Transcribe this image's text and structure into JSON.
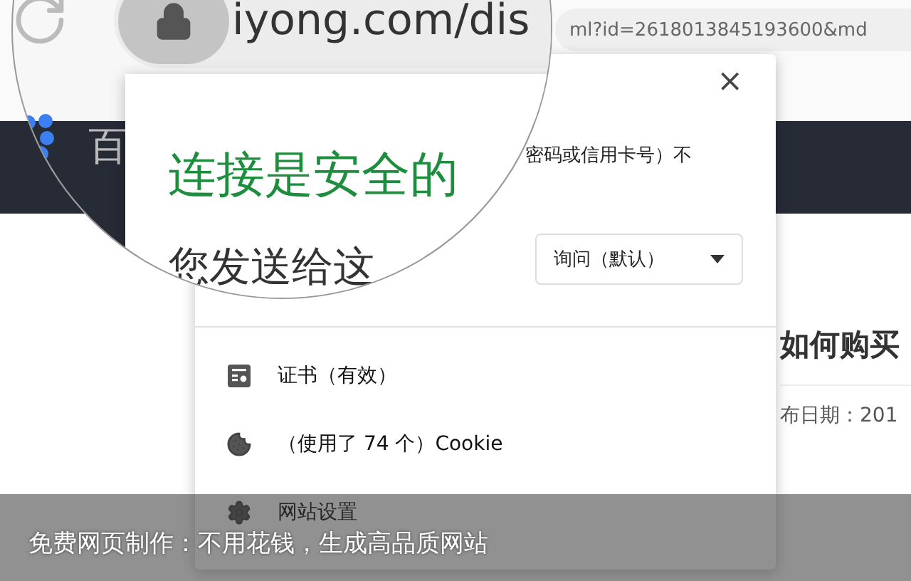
{
  "toolbar": {
    "url_tail": "ml?id=2618013845193600&md"
  },
  "magnifier": {
    "url": "iyong.com/dis",
    "site_logo_text": "百",
    "title": "连接是安全的",
    "text": "您发送给这"
  },
  "popup": {
    "close": "×",
    "info_text": "密码或信用卡号）不",
    "permission": {
      "value": "询问（默认）"
    },
    "items": [
      {
        "kind": "certificate",
        "label": "证书（有效）"
      },
      {
        "kind": "cookie",
        "label": "（使用了 74 个）Cookie"
      },
      {
        "kind": "settings",
        "label": "网站设置"
      }
    ]
  },
  "page": {
    "heading": "如何购买",
    "date": "布日期：201"
  },
  "caption": "免费网页制作：不用花钱，生成高品质网站"
}
